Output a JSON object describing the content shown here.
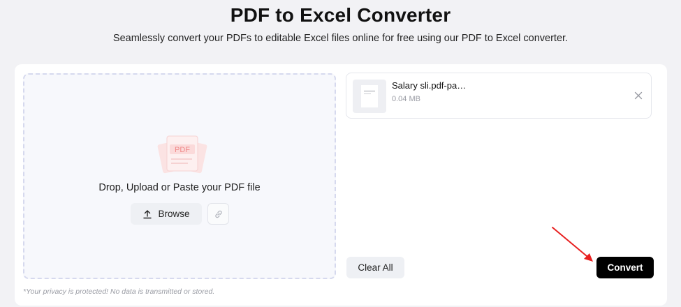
{
  "header": {
    "title": "PDF to Excel Converter",
    "subtitle": "Seamlessly convert your PDFs to editable Excel files online for free using our PDF to Excel converter."
  },
  "upload": {
    "illustration_label": "PDF",
    "prompt": "Drop, Upload or Paste your PDF file",
    "browse_label": "Browse",
    "browse_icon": "upload-icon",
    "link_icon": "link-icon",
    "privacy_note": "*Your privacy is protected! No data is transmitted or stored."
  },
  "files": [
    {
      "name": "Salary sli.pdf-pa…",
      "size": "0.04 MB",
      "remove_icon": "close-icon"
    }
  ],
  "actions": {
    "clear_label": "Clear All",
    "convert_label": "Convert"
  },
  "colors": {
    "page_background": "#f2f2f5",
    "dropzone_border": "#d6d9ee",
    "illustration_red": "#f08a8a",
    "convert_button": "#000000",
    "annotation_arrow": "#e82020"
  }
}
